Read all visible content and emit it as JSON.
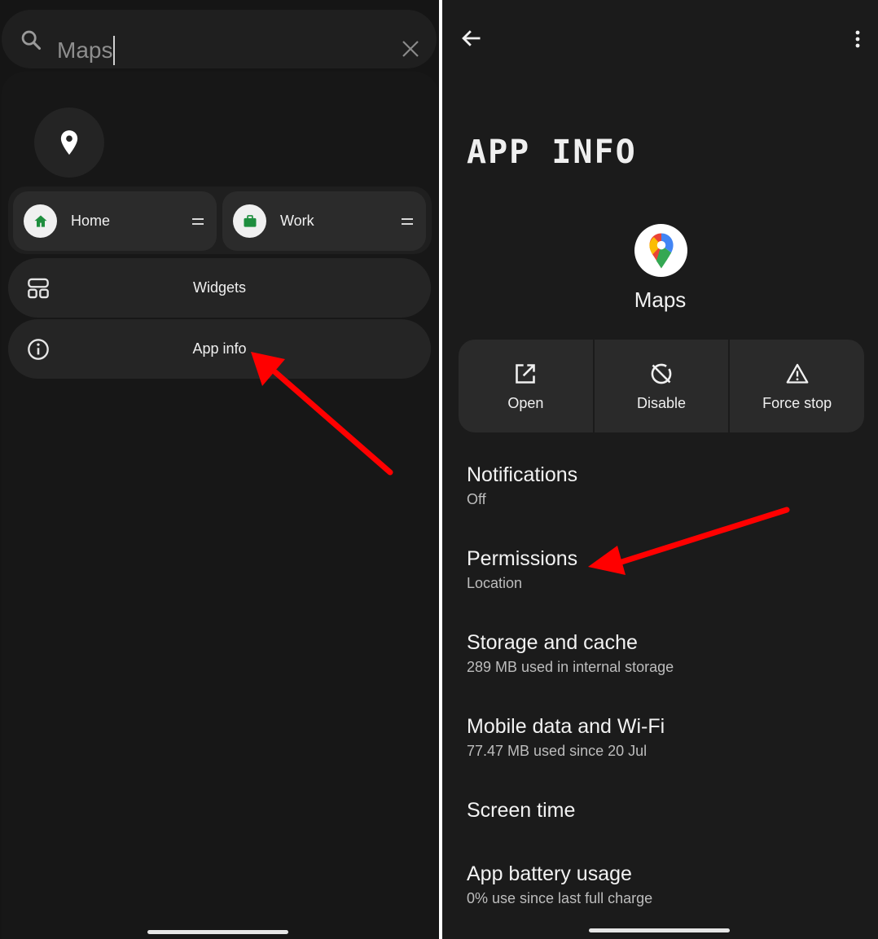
{
  "left": {
    "search": {
      "value": "Maps"
    },
    "shortcuts": [
      {
        "label": "Home",
        "icon": "home-icon",
        "color": "#1e8e3e"
      },
      {
        "label": "Work",
        "icon": "briefcase-icon",
        "color": "#1e8e3e"
      }
    ],
    "menu": [
      {
        "label": "Widgets",
        "icon": "widgets-icon"
      },
      {
        "label": "App info",
        "icon": "info-icon"
      }
    ]
  },
  "right": {
    "title": "APP INFO",
    "app_name": "Maps",
    "actions": [
      {
        "label": "Open",
        "icon": "open-external-icon"
      },
      {
        "label": "Disable",
        "icon": "disable-icon"
      },
      {
        "label": "Force stop",
        "icon": "warning-icon"
      }
    ],
    "settings": [
      {
        "title": "Notifications",
        "subtitle": "Off"
      },
      {
        "title": "Permissions",
        "subtitle": "Location"
      },
      {
        "title": "Storage and cache",
        "subtitle": "289 MB used in internal storage"
      },
      {
        "title": "Mobile data and Wi-Fi",
        "subtitle": "77.47 MB used since 20 Jul"
      },
      {
        "title": "Screen time",
        "subtitle": ""
      },
      {
        "title": "App battery usage",
        "subtitle": "0% use since last full charge"
      }
    ]
  },
  "colors": {
    "background": "#151515",
    "surface": "#252525",
    "accent_green": "#1e8e3e",
    "annotation_arrow": "#ff0000"
  }
}
